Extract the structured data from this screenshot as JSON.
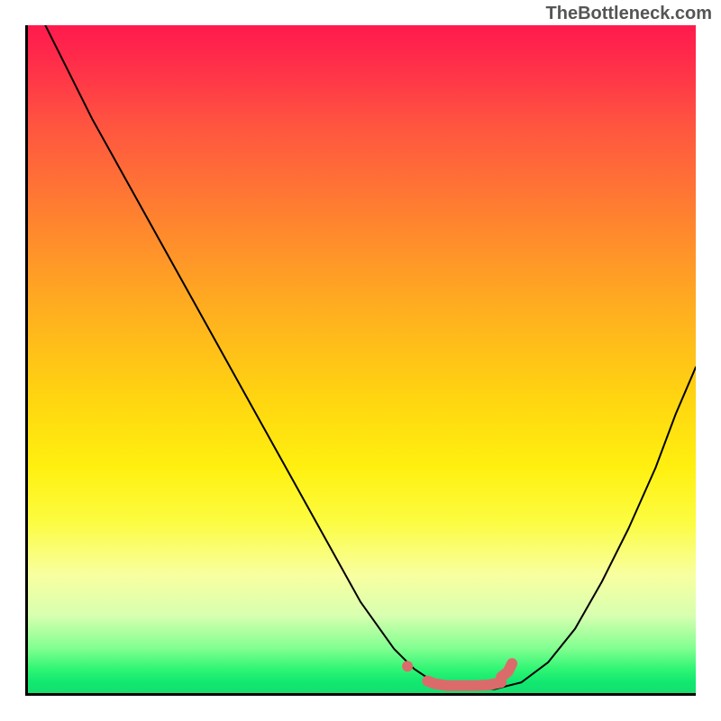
{
  "watermark": "TheBottleneck.com",
  "chart_data": {
    "type": "line",
    "title": "",
    "xlabel": "",
    "ylabel": "",
    "xlim": [
      0,
      100
    ],
    "ylim": [
      0,
      100
    ],
    "grid": false,
    "series": [
      {
        "name": "curve",
        "color": "#000000",
        "x": [
          3,
          6,
          10,
          15,
          20,
          25,
          30,
          35,
          40,
          45,
          50,
          55,
          58,
          61,
          64,
          67,
          70,
          74,
          78,
          82,
          86,
          90,
          94,
          97,
          100
        ],
        "values": [
          100,
          94,
          86,
          77,
          68,
          59,
          50,
          41,
          32,
          23,
          14,
          7,
          4,
          2,
          1,
          1,
          1,
          2,
          5,
          10,
          17,
          25,
          34,
          42,
          49
        ]
      }
    ],
    "highlight": {
      "color": "#db6b6b",
      "segments": [
        {
          "type": "dot",
          "x": 57,
          "y": 4.4
        },
        {
          "type": "stroke",
          "x": [
            60,
            61,
            63,
            65,
            67,
            69,
            71
          ],
          "y": [
            2.2,
            1.8,
            1.5,
            1.5,
            1.5,
            1.6,
            2.0
          ]
        },
        {
          "type": "stroke",
          "x": [
            71,
            71.5,
            72,
            72.3,
            72.6
          ],
          "y": [
            2.8,
            3.2,
            3.6,
            4.2,
            4.8
          ]
        }
      ]
    },
    "background_gradient": {
      "stops": [
        {
          "pos": 0.0,
          "color": "#ff1a4d"
        },
        {
          "pos": 0.15,
          "color": "#ff5540"
        },
        {
          "pos": 0.42,
          "color": "#ffad20"
        },
        {
          "pos": 0.66,
          "color": "#fff010"
        },
        {
          "pos": 0.82,
          "color": "#f8ffa0"
        },
        {
          "pos": 0.93,
          "color": "#80ff90"
        },
        {
          "pos": 1.0,
          "color": "#18dd6e"
        }
      ]
    }
  }
}
